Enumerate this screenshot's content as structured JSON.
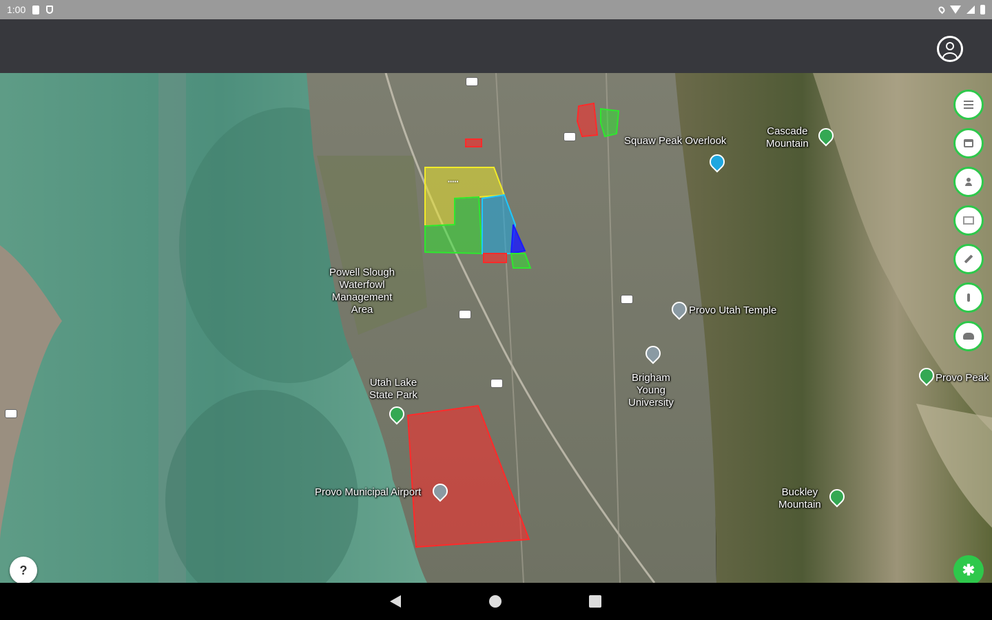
{
  "status_bar": {
    "time": "1:00"
  },
  "app_bar": {
    "account_icon": "account-circle-icon"
  },
  "map": {
    "labels": {
      "square_peak": "Squaw Peak Overlook",
      "cascade": "Cascade\nMountain",
      "powell": "Powell Slough\nWaterfowl\nManagement\nArea",
      "temple": "Provo Utah Temple",
      "utah_lake": "Utah Lake\nState Park",
      "byu": "Brigham\nYoung\nUniversity",
      "provo_peak": "Provo Peak",
      "airport": "Provo Municipal Airport",
      "buckley": "Buckley\nMountain"
    },
    "zone_colors": {
      "red": "#ff2a2a",
      "green": "#2ee82e",
      "yellow": "#e8e22e",
      "blue": "#1a8cff",
      "navy": "#1a1aff"
    }
  },
  "tools": {
    "icons": [
      "list-icon",
      "calendar-icon",
      "person-icon",
      "map-icon",
      "pencil-icon",
      "info-icon",
      "group-icon"
    ]
  },
  "help": {
    "label": "?"
  },
  "fab": {
    "label": "✱"
  }
}
